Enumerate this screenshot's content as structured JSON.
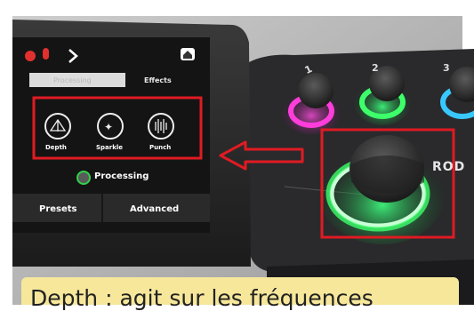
{
  "screen": {
    "tabs": [
      {
        "label": "Processing",
        "active": true
      },
      {
        "label": "Effects",
        "active": false
      }
    ],
    "effects": [
      {
        "label": "Depth",
        "icon": "depth-icon"
      },
      {
        "label": "Sparkle",
        "icon": "sparkle-icon"
      },
      {
        "label": "Punch",
        "icon": "punch-icon"
      }
    ],
    "processing_toggle": "Processing",
    "bottom": {
      "presets": "Presets",
      "advanced": "Advanced"
    },
    "icons": {
      "mic": "mic-muted-icon",
      "next": "chevron-right-icon",
      "home": "home-icon"
    }
  },
  "device": {
    "knob_numbers": [
      "1",
      "2",
      "3"
    ],
    "brand": "ROD"
  },
  "annotations": {
    "highlight_color": "#e01b22",
    "caption": "Depth : agit sur les fréquences"
  },
  "colors": {
    "ring_pink": "#ff3ddb",
    "ring_green": "#3dff6a",
    "ring_blue": "#38c8ff",
    "caption_bg": "#f6e79b"
  }
}
